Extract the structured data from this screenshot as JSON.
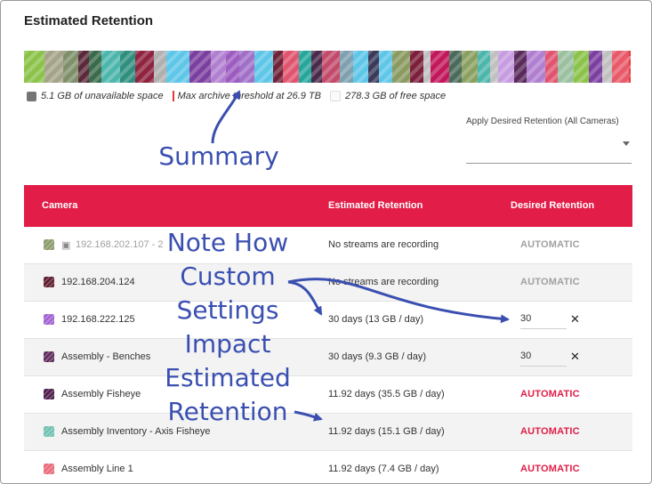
{
  "panel": {
    "title": "Estimated Retention",
    "bar_colors": [
      "#8bc34a",
      "#a5a48a",
      "#7e8f6a",
      "#5b2a3a",
      "#3a6b4a",
      "#4db6ac",
      "#2f8f7f",
      "#8e2440",
      "#b0b0b0",
      "#5ec6e8",
      "#7b3fa0",
      "#b07fd0",
      "#9c5cc0",
      "#a070c8",
      "#5ec6e8",
      "#6f2236",
      "#e05470",
      "#26a69a",
      "#4a2a4a",
      "#c24a6a",
      "#7fa0b0",
      "#5ec6e8",
      "#3a3a5a",
      "#5ec6e8",
      "#8a9a60",
      "#7b1f3a",
      "#c0c0c0",
      "#c2185b",
      "#4a6a5a",
      "#8aa060",
      "#4db6ac",
      "#c0c0c0",
      "#c79ce0",
      "#5a2a5a",
      "#b07fd0",
      "#e05470",
      "#9bc0a0",
      "#8bc34a",
      "#7b3fa0",
      "#c0c0c0",
      "#e85a6a"
    ],
    "legend": {
      "unavailable": "5.1 GB of unavailable space",
      "threshold": "Max archive threshold at 26.9 TB",
      "free": "278.3 GB of free space",
      "unavailable_color": "#757575",
      "threshold_color": "#e53935"
    },
    "apply_label": "Apply Desired Retention (All Cameras)",
    "apply_value": ""
  },
  "table": {
    "headers": {
      "camera": "Camera",
      "estimated": "Estimated Retention",
      "desired": "Desired Retention"
    },
    "rows": [
      {
        "name": "192.168.202.107 - 2",
        "icon_color": "#8a9a6a",
        "estimated": "No streams are recording",
        "desired": "AUTOMATIC",
        "desired_style": "grey",
        "muted": true,
        "video_off": true
      },
      {
        "name": "192.168.204.124",
        "icon_color": "#5b1a2a",
        "estimated": "No streams are recording",
        "desired": "AUTOMATIC",
        "desired_style": "grey"
      },
      {
        "name": "192.168.222.125",
        "icon_color": "#a060d0",
        "estimated": "30 days (13 GB / day)",
        "desired": "30",
        "desired_style": "input"
      },
      {
        "name": "Assembly - Benches",
        "icon_color": "#5b2a5a",
        "estimated": "30 days (9.3 GB / day)",
        "desired": "30",
        "desired_style": "input"
      },
      {
        "name": "Assembly Fisheye",
        "icon_color": "#4a1a4a",
        "estimated": "11.92 days (35.5 GB / day)",
        "desired": "AUTOMATIC",
        "desired_style": "red"
      },
      {
        "name": "Assembly Inventory - Axis Fisheye",
        "icon_color": "#6fc0b0",
        "estimated": "11.92 days (15.1 GB / day)",
        "desired": "AUTOMATIC",
        "desired_style": "red"
      },
      {
        "name": "Assembly Line 1",
        "icon_color": "#e86a7a",
        "estimated": "11.92 days (7.4 GB / day)",
        "desired": "AUTOMATIC",
        "desired_style": "red"
      }
    ]
  },
  "annotations": {
    "summary": "Summary",
    "note_lines": [
      "Note How",
      "Custom",
      "Settings",
      "Impact",
      "Estimated",
      "Retention"
    ]
  }
}
